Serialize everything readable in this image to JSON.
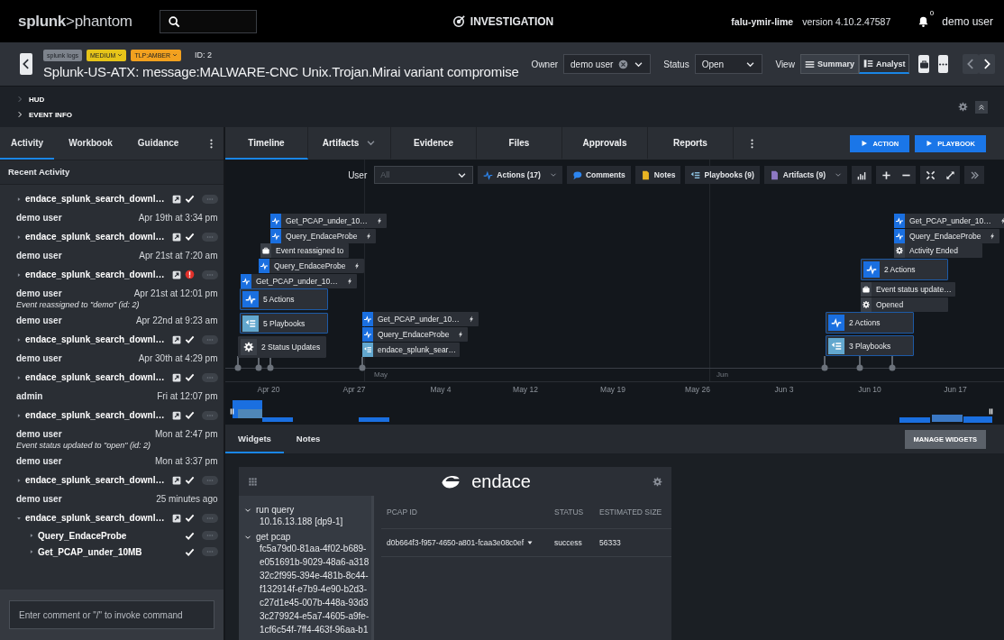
{
  "top_bar": {
    "logo": "**splunk**>phantom",
    "section_title": "INVESTIGATION",
    "host": "falu-ymir-lime",
    "version": "version 4.10.2.47587",
    "notifications": "0",
    "user": "demo user"
  },
  "event_header": {
    "tags": [
      {
        "label": "splunk logs",
        "color": "#7d838c",
        "dropdown": false
      },
      {
        "label": "MEDIUM",
        "color": "#e6c419",
        "dropdown": true
      },
      {
        "label": "TLP:AMBER",
        "color": "#f2a11f",
        "dropdown": true
      }
    ],
    "id": "ID: 2",
    "title": "Splunk-US-ATX: message:MALWARE-CNC Unix.Trojan.Mirai variant compromise",
    "owner_label": "Owner",
    "owner": "demo user",
    "status_label": "Status",
    "status": "Open",
    "view_label": "View",
    "views": [
      {
        "label": "Summary",
        "selected": false
      },
      {
        "label": "Analyst",
        "selected": true
      }
    ]
  },
  "hud": {
    "sections": [
      {
        "label": "HUD",
        "expanded": false
      },
      {
        "label": "EVENT INFO",
        "expanded": false
      }
    ]
  },
  "left_panel": {
    "tabs": [
      {
        "label": "Activity",
        "selected": true
      },
      {
        "label": "Workbook",
        "selected": false
      },
      {
        "label": "Guidance",
        "selected": false
      }
    ],
    "heading": "Recent Activity",
    "activity": [
      {
        "kind": "playbook",
        "label": "endace_splunk_search_downl…",
        "error": false,
        "expanded": false
      },
      {
        "kind": "user",
        "name": "demo user",
        "time": "Apr 19th at 3:34 pm"
      },
      {
        "kind": "playbook",
        "label": "endace_splunk_search_downl…",
        "error": false,
        "expanded": false
      },
      {
        "kind": "user",
        "name": "demo user",
        "time": "Apr 21st at 7:20 am"
      },
      {
        "kind": "playbook",
        "label": "endace_splunk_search_downl…",
        "error": true,
        "expanded": false
      },
      {
        "kind": "user",
        "name": "demo user",
        "time": "Apr 21st at 12:01 pm"
      },
      {
        "kind": "note",
        "text": "Event reassigned to \"demo\" (id: 2)"
      },
      {
        "kind": "user",
        "name": "demo user",
        "time": "Apr 22nd at 9:23 am"
      },
      {
        "kind": "playbook",
        "label": "endace_splunk_search_downl…",
        "error": false,
        "expanded": false
      },
      {
        "kind": "user",
        "name": "demo user",
        "time": "Apr 30th at 4:29 pm"
      },
      {
        "kind": "playbook",
        "label": "endace_splunk_search_downl…",
        "error": false,
        "expanded": false
      },
      {
        "kind": "user",
        "name": "admin",
        "time": "Fri at 12:07 pm"
      },
      {
        "kind": "playbook",
        "label": "endace_splunk_search_downl…",
        "error": false,
        "expanded": false
      },
      {
        "kind": "user",
        "name": "demo user",
        "time": "Mon at 2:47 pm"
      },
      {
        "kind": "note",
        "text": "Event status updated to \"open\" (id: 2)"
      },
      {
        "kind": "user",
        "name": "demo user",
        "time": "Mon at 3:37 pm"
      },
      {
        "kind": "playbook",
        "label": "endace_splunk_search_downl…",
        "error": false,
        "expanded": false
      },
      {
        "kind": "user",
        "name": "demo user",
        "time": "25 minutes ago"
      },
      {
        "kind": "playbook",
        "label": "endace_splunk_search_downl…",
        "error": false,
        "expanded": true,
        "children": [
          {
            "label": "Query_EndaceProbe",
            "error": false,
            "expanded": false
          },
          {
            "label": "Get_PCAP_under_10MB",
            "error": false,
            "expanded": false
          }
        ]
      }
    ],
    "comment": {
      "placeholder": "Enter comment or \"/\" to invoke command"
    }
  },
  "workspace": {
    "tabs": [
      {
        "label": "Timeline",
        "selected": true,
        "dropdown": false
      },
      {
        "label": "Artifacts",
        "selected": false,
        "dropdown": true
      },
      {
        "label": "Evidence",
        "selected": false,
        "dropdown": false
      },
      {
        "label": "Files",
        "selected": false,
        "dropdown": false
      },
      {
        "label": "Approvals",
        "selected": false,
        "dropdown": false
      },
      {
        "label": "Reports",
        "selected": false,
        "dropdown": false
      }
    ],
    "buttons": [
      "ACTION",
      "PLAYBOOK"
    ]
  },
  "timeline": {
    "user_label": "User",
    "user_filter": {
      "placeholder": "All"
    },
    "filters": [
      {
        "kind": "actions",
        "label": "Actions (17)",
        "dropdown": true
      },
      {
        "kind": "comments",
        "label": "Comments",
        "dropdown": false
      },
      {
        "kind": "notes",
        "label": "Notes",
        "dropdown": false
      },
      {
        "kind": "playbooks",
        "label": "Playbooks (9)",
        "dropdown": false
      },
      {
        "kind": "artifacts",
        "label": "Artifacts (9)",
        "dropdown": true
      }
    ],
    "events": [
      {
        "kind": "action",
        "label": "Get_PCAP_under_10…",
        "automated": true
      },
      {
        "kind": "action",
        "label": "Query_EndaceProbe",
        "automated": true
      },
      {
        "kind": "event",
        "label": "Event reassigned to",
        "automated": false
      },
      {
        "kind": "action",
        "label": "Query_EndaceProbe",
        "automated": true
      },
      {
        "kind": "action",
        "label": "Get_PCAP_under_10…",
        "automated": true
      },
      {
        "kind": "action_group",
        "label": "5 Actions",
        "automated": false
      },
      {
        "kind": "playbook_group",
        "label": "5 Playbooks",
        "automated": false
      },
      {
        "kind": "status_group",
        "label": "2 Status Updates",
        "automated": false
      },
      {
        "kind": "action",
        "label": "Get_PCAP_under_10…",
        "automated": true
      },
      {
        "kind": "action",
        "label": "Query_EndaceProbe",
        "automated": true
      },
      {
        "kind": "playbook",
        "label": "endace_splunk_sear…",
        "automated": false
      },
      {
        "kind": "action",
        "label": "Get_PCAP_under_10…",
        "automated": true
      },
      {
        "kind": "action",
        "label": "Query_EndaceProbe",
        "automated": true
      },
      {
        "kind": "status",
        "label": "Activity Ended",
        "automated": false
      },
      {
        "kind": "action_group",
        "label": "2 Actions",
        "automated": false
      },
      {
        "kind": "event",
        "label": "Event status update…",
        "automated": false
      },
      {
        "kind": "status",
        "label": "Opened",
        "automated": false
      },
      {
        "kind": "action_group",
        "label": "2 Actions",
        "automated": false
      },
      {
        "kind": "playbook_group",
        "label": "3 Playbooks",
        "automated": false
      }
    ],
    "months": [
      "May",
      "Jun"
    ],
    "dates": [
      "Apr 20",
      "Apr 27",
      "May 4",
      "May 12",
      "May 19",
      "May 26",
      "Jun 3",
      "Jun 10",
      "Jun 17"
    ]
  },
  "bottom_panel": {
    "tabs": [
      {
        "label": "Widgets",
        "selected": true
      },
      {
        "label": "Notes",
        "selected": false
      }
    ],
    "manage_button": "MANAGE WIDGETS",
    "widget": {
      "brand": "endace",
      "tree": [
        {
          "label": "run query",
          "expanded": true,
          "children": [
            {
              "label": "10.16.13.188 [dp9-1]"
            }
          ]
        },
        {
          "label": "get pcap",
          "expanded": true,
          "children": [
            {
              "label": "fc5a79d0-81aa-4f02-b689-"
            },
            {
              "label": "e051691b-9029-48a6-a318"
            },
            {
              "label": "32c2f995-394e-481b-8c44-"
            },
            {
              "label": "f132914f-e7b9-4e90-b2d3-"
            },
            {
              "label": "c27d1e45-007b-448a-93d3"
            },
            {
              "label": "3c279924-e5a7-4605-a9fe-"
            },
            {
              "label": "1cf6c54f-7ff4-463f-96aa-b1"
            }
          ]
        }
      ],
      "columns": [
        "PCAP ID",
        "STATUS",
        "ESTIMATED SIZE"
      ],
      "rows": [
        [
          "d0b664f3-f957-4650-a801-fcaa3e08c0ef",
          "success",
          "56333"
        ]
      ]
    }
  }
}
